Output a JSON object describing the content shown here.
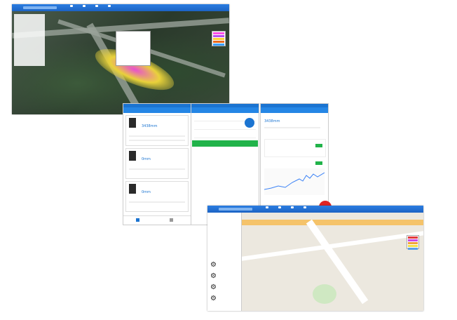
{
  "window_top": {
    "nav": [
      "",
      "",
      "",
      ""
    ],
    "legend_colors": [
      "#ff4de6",
      "#b84cf0",
      "#ffd23a",
      "#e96a1f",
      "#3aa0ff"
    ]
  },
  "phone1": {
    "header": "",
    "cards": [
      {
        "name": "",
        "value": "3438mm",
        "status": ""
      },
      {
        "name": "",
        "value": "0mm",
        "status": ""
      },
      {
        "name": "",
        "value": "0mm",
        "status": ""
      }
    ]
  },
  "phone2": {
    "header": "",
    "circle": "",
    "confirm": ""
  },
  "phone3": {
    "header": "",
    "value": "3438mm"
  },
  "window_bottom": {
    "legend_colors": [
      "#e23a3a",
      "#c94ae6",
      "#f0a33a",
      "#f5e04a",
      "#5aa0e6"
    ]
  }
}
